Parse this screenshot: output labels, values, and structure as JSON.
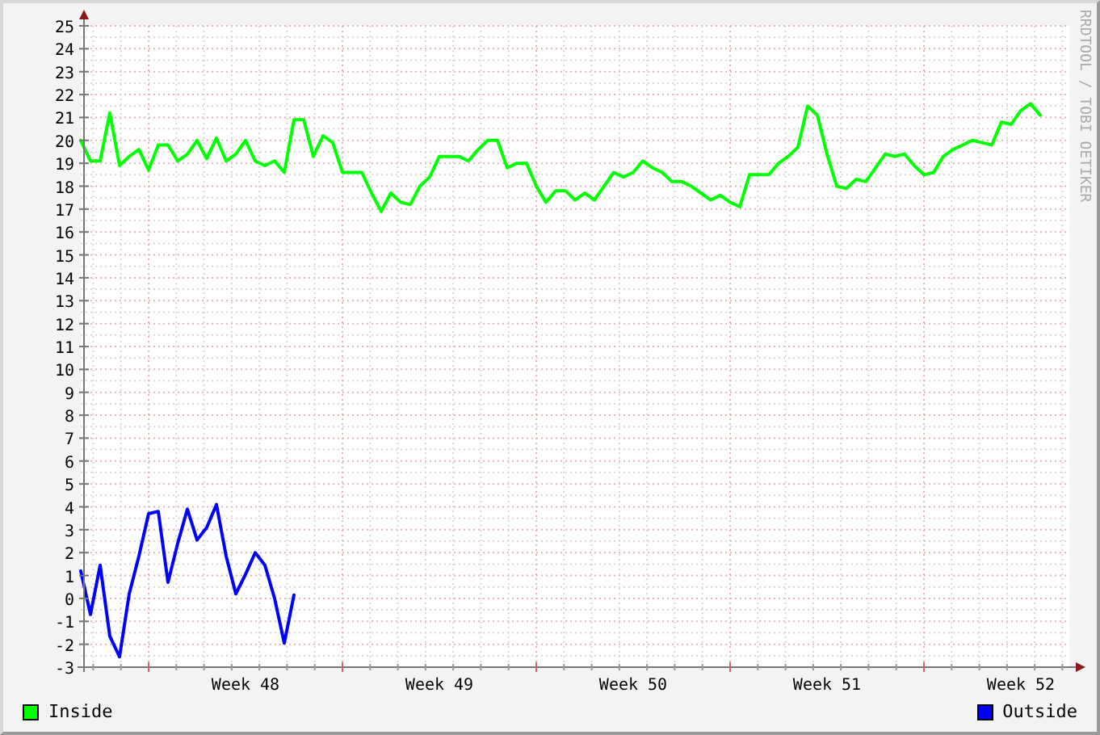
{
  "chart": {
    "credit": "RRDTOOL / TOBI OETIKER",
    "chart_data": {
      "type": "line",
      "grid": true,
      "ylim": [
        -3,
        25
      ],
      "yticks": [
        -3,
        -2,
        -1,
        0,
        1,
        2,
        3,
        4,
        5,
        6,
        7,
        8,
        9,
        10,
        11,
        12,
        13,
        14,
        15,
        16,
        17,
        18,
        19,
        20,
        21,
        22,
        23,
        24,
        25
      ],
      "categories": [
        null,
        null,
        null,
        null,
        null,
        null,
        null,
        null,
        null,
        null,
        null,
        null,
        null,
        null,
        null,
        null,
        null,
        "Week 48",
        null,
        null,
        null,
        null,
        null,
        null,
        null,
        null,
        null,
        null,
        null,
        null,
        null,
        null,
        null,
        null,
        null,
        null,
        null,
        "Week 49",
        null,
        null,
        null,
        null,
        null,
        null,
        null,
        null,
        null,
        null,
        null,
        null,
        null,
        null,
        null,
        null,
        null,
        null,
        null,
        "Week 50",
        null,
        null,
        null,
        null,
        null,
        null,
        null,
        null,
        null,
        null,
        null,
        null,
        null,
        null,
        null,
        null,
        null,
        null,
        null,
        "Week 51",
        null,
        null,
        null,
        null,
        null,
        null,
        null,
        null,
        null,
        null,
        null,
        null,
        null,
        null,
        null,
        null,
        null,
        null,
        null,
        "Week 52",
        null,
        null
      ],
      "series": [
        {
          "name": "Inside",
          "color": "#00ff00",
          "values": [
            20.0,
            19.1,
            19.1,
            21.2,
            18.9,
            19.3,
            19.6,
            18.7,
            19.8,
            19.8,
            19.1,
            19.4,
            20.0,
            19.2,
            20.1,
            19.1,
            19.4,
            20.0,
            19.1,
            18.9,
            19.1,
            18.6,
            20.9,
            20.9,
            19.3,
            20.2,
            19.9,
            18.6,
            18.6,
            18.6,
            17.7,
            16.9,
            17.7,
            17.3,
            17.2,
            18.0,
            18.4,
            19.3,
            19.3,
            19.3,
            19.1,
            19.6,
            20.0,
            20.0,
            18.8,
            19.0,
            19.0,
            18.0,
            17.3,
            17.8,
            17.8,
            17.4,
            17.7,
            17.4,
            18.0,
            18.6,
            18.4,
            18.6,
            19.1,
            18.8,
            18.6,
            18.2,
            18.2,
            18.0,
            17.7,
            17.4,
            17.6,
            17.3,
            17.1,
            18.5,
            18.5,
            18.5,
            19.0,
            19.3,
            19.7,
            21.5,
            21.1,
            19.4,
            18.0,
            17.9,
            18.3,
            18.2,
            18.8,
            19.4,
            19.3,
            19.4,
            18.9,
            18.5,
            18.6,
            19.3,
            19.6,
            19.8,
            20.0,
            19.9,
            19.8,
            20.8,
            20.7,
            21.3,
            21.6,
            21.1
          ]
        },
        {
          "name": "Outside",
          "color": "#0000ff",
          "values": [
            1.2,
            -0.7,
            1.45,
            -1.65,
            -2.55,
            0.2,
            1.85,
            3.7,
            3.8,
            0.7,
            2.4,
            3.9,
            2.55,
            3.1,
            4.1,
            1.85,
            0.2,
            1.05,
            2.0,
            1.45,
            0,
            -1.95,
            0.15,
            null,
            null,
            null,
            null,
            null,
            null,
            null,
            null,
            null,
            null,
            null,
            null,
            null,
            null,
            null,
            null,
            null,
            null,
            null,
            null,
            null,
            null,
            null,
            null,
            null,
            null,
            null,
            null,
            null,
            null,
            null,
            null,
            null,
            null,
            null,
            null,
            null,
            null,
            null,
            null,
            null,
            null,
            null,
            null,
            null,
            null,
            null,
            null,
            null,
            null,
            null,
            null,
            null,
            null,
            null,
            null,
            null,
            null,
            null,
            null,
            null,
            null,
            null,
            null,
            null,
            null,
            null,
            null,
            null,
            null,
            null,
            null,
            null,
            null,
            null,
            null,
            null
          ]
        }
      ]
    }
  }
}
